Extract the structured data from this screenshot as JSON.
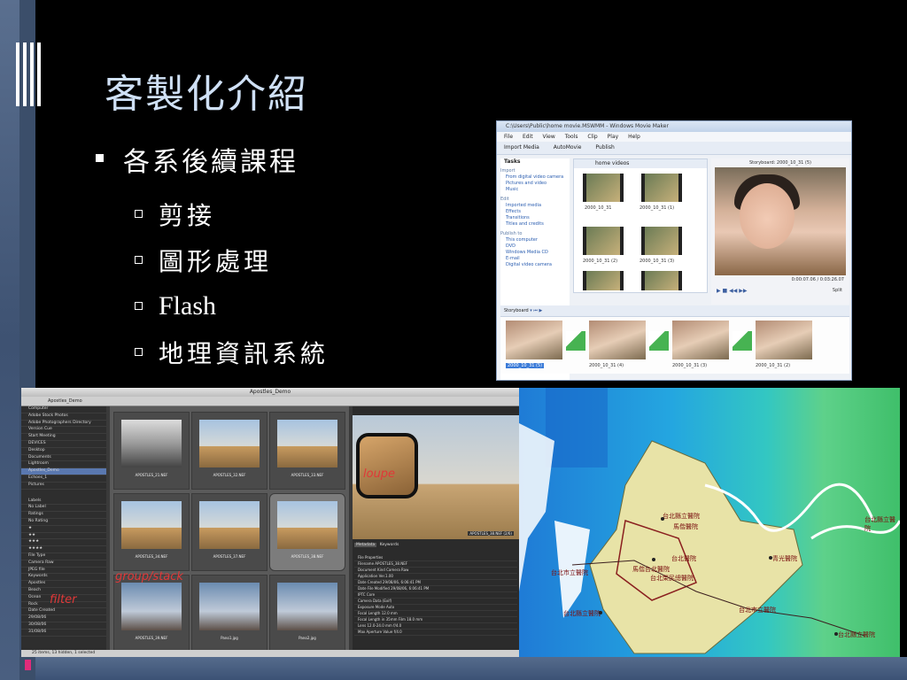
{
  "slide": {
    "title": "客製化介紹",
    "bullet": "各系後續課程",
    "sub_items": [
      "剪接",
      "圖形處理",
      "Flash",
      "地理資訊系統"
    ]
  },
  "movie_maker": {
    "window_title": "C:\\Users\\Public\\home movie.MSWMM - Windows Movie Maker",
    "menu": [
      "File",
      "Edit",
      "View",
      "Tools",
      "Clip",
      "Play",
      "Help"
    ],
    "toolbar": [
      "Import Media",
      "AutoMovie",
      "Publish"
    ],
    "tasks_label": "Tasks",
    "collection": "home videos",
    "storyboard_title": "Storyboard: 2000_10_31 (5)",
    "task_sections": [
      {
        "title": "Import",
        "links": [
          "From digital video camera",
          "Pictures and video",
          "Music"
        ]
      },
      {
        "title": "Edit",
        "links": [
          "Imported media",
          "Effects",
          "Transitions",
          "Titles and credits"
        ]
      },
      {
        "title": "Publish to",
        "links": [
          "This computer",
          "DVD",
          "Windows Media CD",
          "E-mail",
          "Digital video camera"
        ]
      }
    ],
    "clips": [
      "2000_10_31",
      "2000_10_31 (1)",
      "2000_10_31 (2)",
      "2000_10_31 (3)"
    ],
    "time_readout": "0:00:07.06 / 0:03:26.07",
    "split_label": "Split",
    "storyboard_label": "Storyboard",
    "strip": [
      "2000_10_31 (5)",
      "2000_10_31 (4)",
      "2000_10_31 (3)",
      "2000_10_31 (2)"
    ]
  },
  "lightroom": {
    "window_title": "Apostles_Demo",
    "location": "Apostles_Demo",
    "folders": [
      "Computer",
      "Adobe Stock Photos",
      "Adobe Photographers Directory",
      "Version Cue",
      "Start Meeting",
      "DEVICES",
      "Desktop",
      "Documents",
      "Lightroom",
      "Apostles_Demo",
      "Echoes_1",
      "Pictures"
    ],
    "filter_rows": [
      "Labels",
      "No Label",
      "Ratings",
      "No Rating",
      "★",
      "★★",
      "★★★",
      "★★★★",
      "File Type",
      "Camera Raw",
      "JPEG file",
      "Keywords",
      "Apostles",
      "Beach",
      "Ocean",
      "Rock",
      "Date Created",
      "29/08/06",
      "30/08/06",
      "31/08/06"
    ],
    "thumbs": [
      "APOSTLES_21.NEF",
      "APOSTLES_32.NEF",
      "APOSTLES_33.NEF",
      "APOSTLES_34.NEF",
      "APOSTLES_37.NEF",
      "APOSTLES_38.NEF",
      "APOSTLES_39.NEF",
      "Pano1.jpg",
      "Pano2.jpg"
    ],
    "preview_caption": "APOSTLES_38.NEF (2/6)",
    "panel_tabs": [
      "Metadata",
      "Keywords"
    ],
    "properties": [
      "File Properties",
      "Filename  APOSTLES_38.NEF",
      "Document Kind  Camera Raw",
      "Application  Ver.1.00",
      "Date Created  29/08/06, 6:06:41 PM",
      "Date File Modified  29/08/06, 6:06:41 PM",
      "IPTC Core",
      "Camera Data (Exif)",
      "Exposure Mode  Auto",
      "Focal Length  12.0 mm",
      "Focal Length in 35mm Film  18.0 mm",
      "Lens  12.0-24.0 mm f/4.0",
      "Max Aperture Value  f/4.0"
    ],
    "status": "25 items, 13 hidden, 1 selected",
    "annotations": [
      "filter",
      "group/stack",
      "loupe"
    ]
  },
  "map": {
    "labels": [
      "台北縣立醫院",
      "馬偕醫院",
      "台北醫院",
      "馬偕台北醫院",
      "台北榮民總醫院",
      "台北市立醫院",
      "台北縣立醫院",
      "台北市立醫院",
      "台北縣立醫院",
      "青光醫院",
      "台北縣立醫院"
    ]
  }
}
